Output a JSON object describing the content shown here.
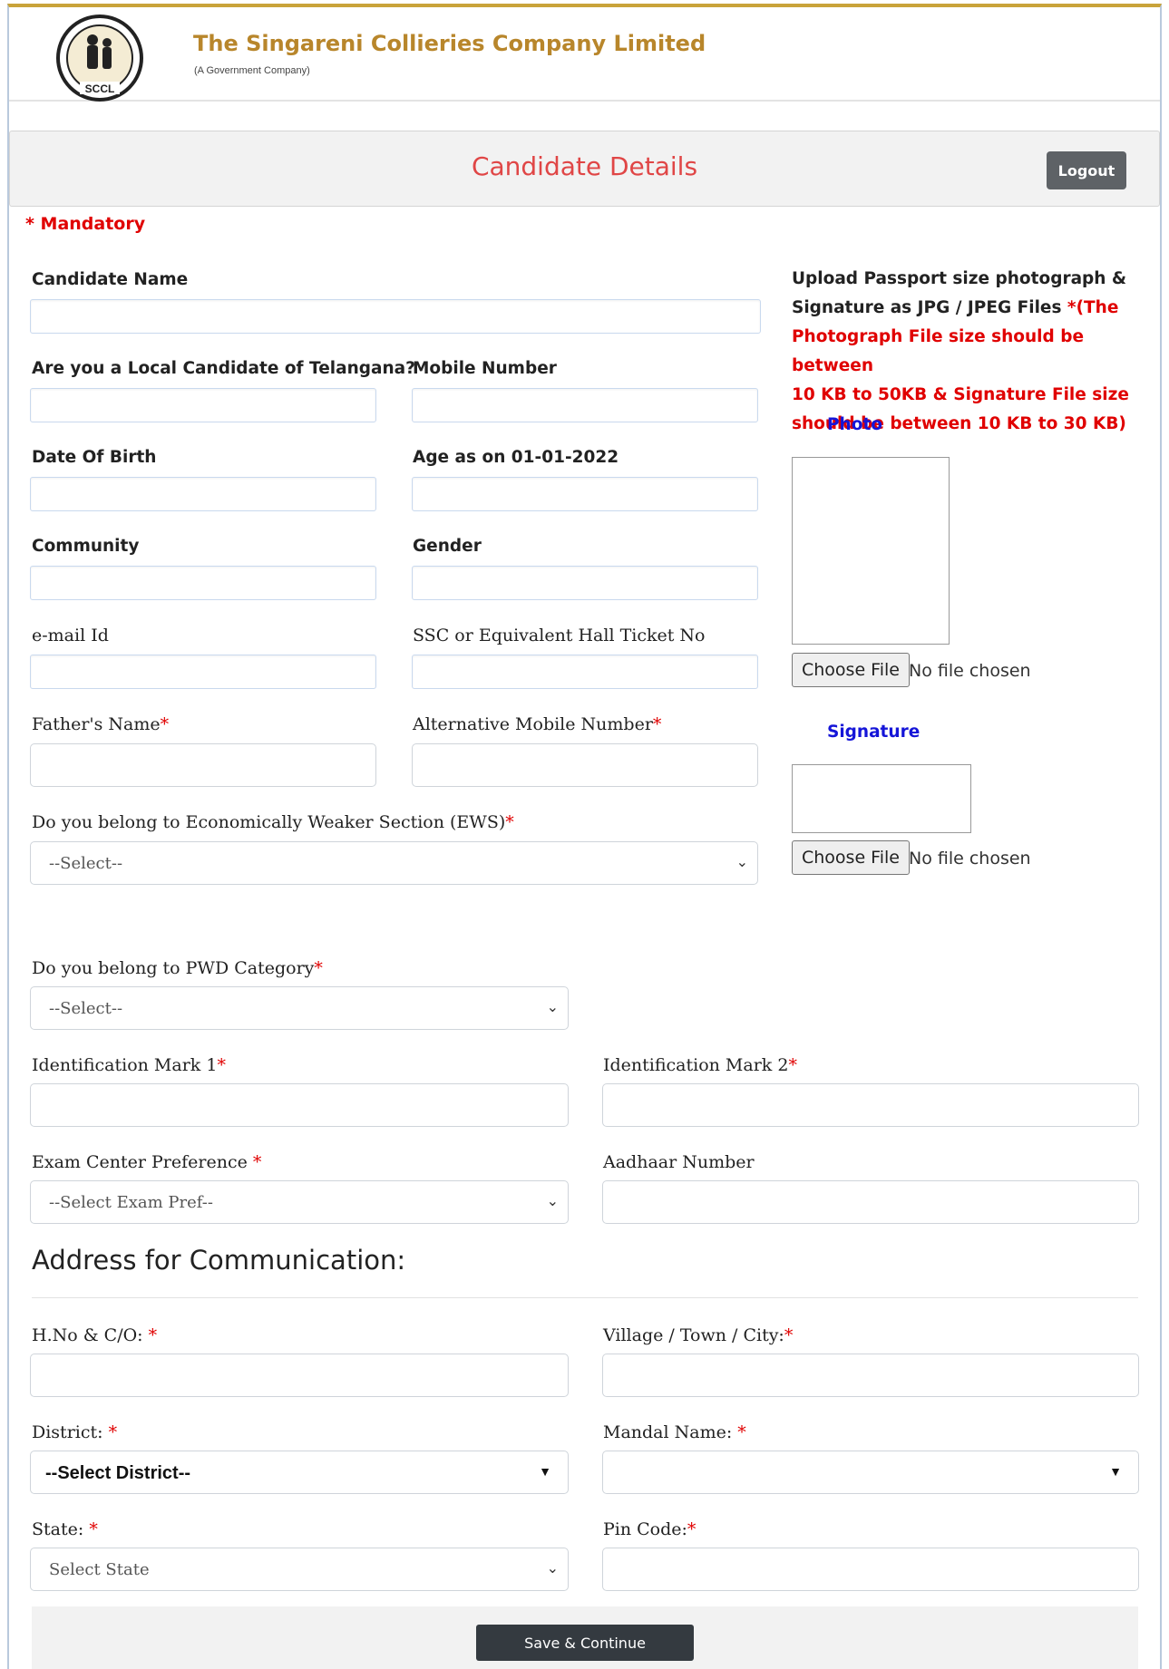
{
  "header": {
    "company_name": "The Singareni Collieries Company Limited",
    "company_sub": "(A Government Company)",
    "logo_text": "SCCL"
  },
  "titlebar": {
    "title": "Candidate Details",
    "logout_label": "Logout"
  },
  "mandatory_note": "* Mandatory",
  "fields": {
    "candidate_name": "Candidate Name",
    "local_candidate": "Are you a Local Candidate of Telangana?",
    "mobile_number": "Mobile Number",
    "dob": "Date Of Birth",
    "age": "Age as on 01-01-2022",
    "community": "Community",
    "gender": "Gender",
    "email": "e-mail Id",
    "ssc_hall_ticket": "SSC or Equivalent Hall Ticket No",
    "fathers_name": "Father's Name",
    "alt_mobile": "Alternative Mobile Number",
    "ews": "Do you belong to Economically Weaker Section (EWS)",
    "pwd": "Do you belong to PWD Category",
    "id_mark1": "Identification Mark 1",
    "id_mark2": "Identification Mark 2",
    "exam_center": "Exam Center Preference ",
    "aadhaar": "Aadhaar Number"
  },
  "selects": {
    "ews_value": "--Select--",
    "pwd_value": "--Select--",
    "exam_value": "--Select Exam Pref--",
    "district_value": "--Select District--",
    "mandal_value": "",
    "state_value": "Select State"
  },
  "upload": {
    "info_line1": "Upload Passport size photograph &",
    "info_line2": "Signature as JPG / JPEG Files ",
    "info_red1": "*(The",
    "info_red2": "Photograph File size should be between",
    "info_red3": "10 KB to 50KB & Signature File size",
    "info_red4": "should be between 10 KB to 30 KB)",
    "photo_label": "Photo",
    "signature_label": "Signature",
    "choose_file": "Choose File",
    "no_file": "No file chosen"
  },
  "address": {
    "heading": "Address for Communication:",
    "hno": "H.No & C/O: ",
    "village": "Village / Town / City:",
    "district": "District: ",
    "mandal": "Mandal Name: ",
    "state": "State: ",
    "pincode": "Pin Code:"
  },
  "required_mark": "*",
  "save_label": "Save & Continue"
}
